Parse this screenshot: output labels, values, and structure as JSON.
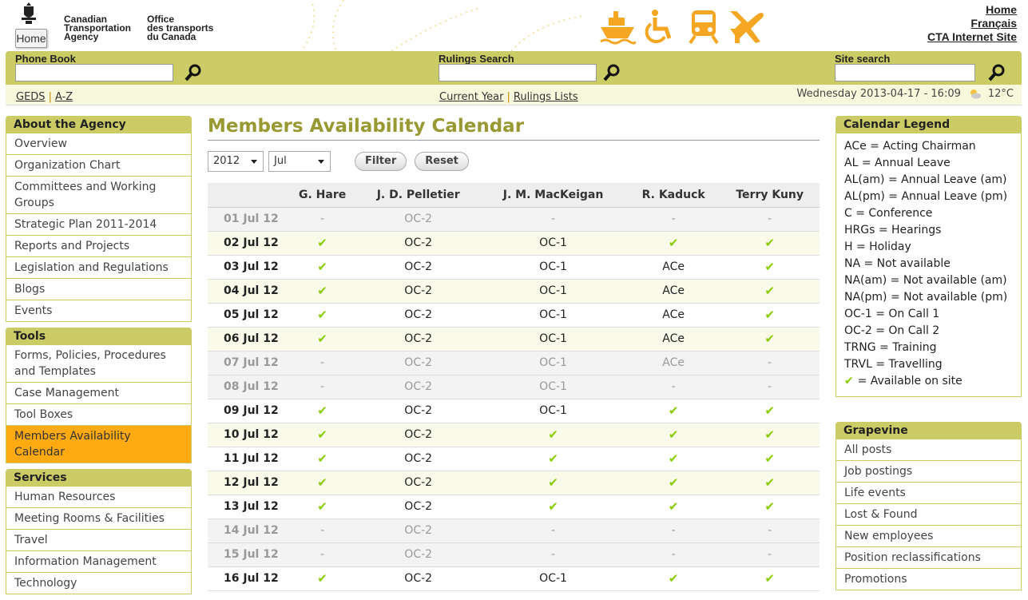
{
  "header": {
    "agency_en": "Canadian\nTransportation\nAgency",
    "agency_fr": "Office\ndes transports\ndu Canada",
    "home_button": "Home",
    "links": {
      "home": "Home",
      "francais": "Français",
      "cta_site": "CTA Internet Site"
    }
  },
  "search": {
    "phone_book_label": "Phone Book",
    "rulings_label": "Rulings Search",
    "site_label": "Site search"
  },
  "linkbar": {
    "geds": "GEDS",
    "az": "A-Z",
    "current_year": "Current Year",
    "rulings_lists": "Rulings Lists",
    "datetime": "Wednesday 2013-04-17 - 16:09",
    "temperature": "12°C"
  },
  "leftnav": {
    "about": {
      "title": "About the Agency",
      "items": [
        "Overview",
        "Organization Chart",
        "Committees and Working Groups",
        "Strategic Plan 2011-2014",
        "Reports and Projects",
        "Legislation and Regulations",
        "Blogs",
        "Events"
      ]
    },
    "tools": {
      "title": "Tools",
      "items": [
        "Forms, Policies, Procedures and Templates",
        "Case Management",
        "Tool Boxes",
        "Members Availability Calendar"
      ]
    },
    "services": {
      "title": "Services",
      "items": [
        "Human Resources",
        "Meeting Rooms & Facilities",
        "Travel",
        "Information Management",
        "Technology"
      ]
    }
  },
  "main": {
    "title": "Members Availability Calendar",
    "year": "2012",
    "month": "Jul",
    "filter_button": "Filter",
    "reset_button": "Reset",
    "columns": [
      "",
      "G. Hare",
      "J. D. Pelletier",
      "J. M. MacKeigan",
      "R. Kaduck",
      "Terry Kuny"
    ],
    "rows": [
      {
        "date": "01 Jul 12",
        "type": "weekend",
        "cells": [
          "-",
          "OC-2",
          "-",
          "-",
          "-"
        ]
      },
      {
        "date": "02 Jul 12",
        "type": "alt",
        "cells": [
          "✔",
          "OC-2",
          "OC-1",
          "✔",
          "✔"
        ]
      },
      {
        "date": "03 Jul 12",
        "type": "",
        "cells": [
          "✔",
          "OC-2",
          "OC-1",
          "ACe",
          "✔"
        ]
      },
      {
        "date": "04 Jul 12",
        "type": "alt",
        "cells": [
          "✔",
          "OC-2",
          "OC-1",
          "ACe",
          "✔"
        ]
      },
      {
        "date": "05 Jul 12",
        "type": "",
        "cells": [
          "✔",
          "OC-2",
          "OC-1",
          "ACe",
          "✔"
        ]
      },
      {
        "date": "06 Jul 12",
        "type": "alt",
        "cells": [
          "✔",
          "OC-2",
          "OC-1",
          "ACe",
          "✔"
        ]
      },
      {
        "date": "07 Jul 12",
        "type": "weekend",
        "cells": [
          "-",
          "OC-2",
          "OC-1",
          "ACe",
          "-"
        ]
      },
      {
        "date": "08 Jul 12",
        "type": "weekend",
        "cells": [
          "-",
          "OC-2",
          "OC-1",
          "-",
          "-"
        ]
      },
      {
        "date": "09 Jul 12",
        "type": "",
        "cells": [
          "✔",
          "OC-2",
          "OC-1",
          "✔",
          "✔"
        ]
      },
      {
        "date": "10 Jul 12",
        "type": "alt",
        "cells": [
          "✔",
          "OC-2",
          "✔",
          "✔",
          "✔"
        ]
      },
      {
        "date": "11 Jul 12",
        "type": "",
        "cells": [
          "✔",
          "OC-2",
          "✔",
          "✔",
          "✔"
        ]
      },
      {
        "date": "12 Jul 12",
        "type": "alt",
        "cells": [
          "✔",
          "OC-2",
          "✔",
          "✔",
          "✔"
        ]
      },
      {
        "date": "13 Jul 12",
        "type": "",
        "cells": [
          "✔",
          "OC-2",
          "✔",
          "✔",
          "✔"
        ]
      },
      {
        "date": "14 Jul 12",
        "type": "weekend",
        "cells": [
          "-",
          "OC-2",
          "-",
          "-",
          "-"
        ]
      },
      {
        "date": "15 Jul 12",
        "type": "weekend",
        "cells": [
          "-",
          "OC-2",
          "-",
          "-",
          "-"
        ]
      },
      {
        "date": "16 Jul 12",
        "type": "",
        "cells": [
          "✔",
          "OC-2",
          "OC-1",
          "✔",
          "✔"
        ]
      }
    ]
  },
  "legend": {
    "title": "Calendar Legend",
    "items": [
      "ACe = Acting Chairman",
      "AL = Annual Leave",
      "AL(am) = Annual Leave (am)",
      "AL(pm) = Annual Leave (pm)",
      "C = Conference",
      "HRGs = Hearings",
      "H = Holiday",
      "NA = Not available",
      "NA(am) = Not available (am)",
      "NA(pm) = Not available (pm)",
      "OC-1 = On Call 1",
      "OC-2 = On Call 2",
      "TRNG = Training",
      "TRVL = Travelling"
    ],
    "available_text": "= Available on site"
  },
  "grapevine": {
    "title": "Grapevine",
    "items": [
      "All posts",
      "Job postings",
      "Life events",
      "Lost & Found",
      "New employees",
      "Position reclassifications",
      "Promotions"
    ]
  },
  "colors": {
    "olive": "#cccc66",
    "title": "#999933",
    "active": "#ffaa11",
    "check": "#88cc00",
    "icons": "#f5a623"
  }
}
